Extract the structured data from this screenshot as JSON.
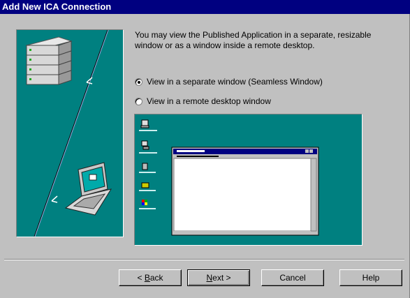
{
  "window": {
    "title": "Add New ICA Connection"
  },
  "description": "You may view the Published Application in a separate, resizable window or as a window inside a remote desktop.",
  "options": [
    {
      "label": "View in a separate window (Seamless Window)",
      "selected": true
    },
    {
      "label": "View in a remote desktop window",
      "selected": false
    }
  ],
  "buttons": {
    "back": {
      "prefix": "< ",
      "mnemonic": "B",
      "rest": "ack"
    },
    "next": {
      "mnemonic": "N",
      "rest": "ext >"
    },
    "cancel": "Cancel",
    "help": "Help"
  },
  "colors": {
    "title_bar": "#000080",
    "face": "#c0c0c0",
    "desktop": "#008080"
  },
  "icons": [
    "server-icon",
    "laptop-icon",
    "my-computer-icon",
    "network-icon",
    "recycle-bin-icon",
    "folder-icon",
    "windows-icon"
  ]
}
